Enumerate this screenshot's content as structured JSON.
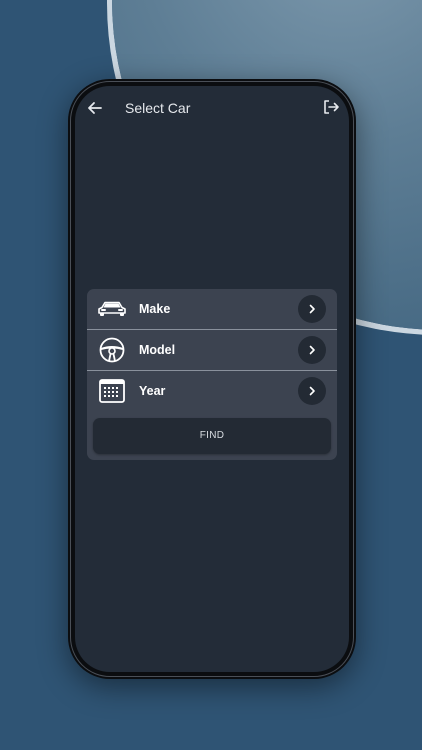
{
  "header": {
    "title": "Select Car",
    "back_icon": "arrow-left-icon",
    "logout_icon": "logout-icon"
  },
  "selector": {
    "rows": [
      {
        "label": "Make",
        "icon": "car-icon"
      },
      {
        "label": "Model",
        "icon": "steering-wheel-icon"
      },
      {
        "label": "Year",
        "icon": "calendar-icon"
      }
    ],
    "find_label": "FIND"
  },
  "colors": {
    "background": "#2f5474",
    "screen": "#232c38",
    "card": "#3c4350",
    "button": "#232a34",
    "text": "#ffffff"
  }
}
